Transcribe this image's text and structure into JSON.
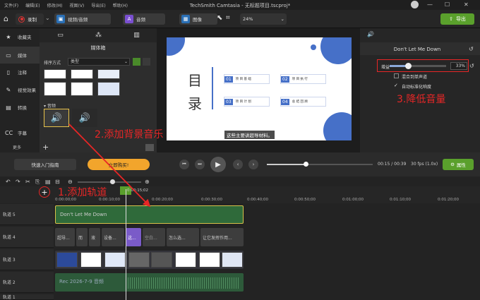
{
  "menu": {
    "items": [
      "文件(F)",
      "编辑(E)",
      "修改(M)",
      "视图(V)",
      "导出(E)",
      "帮助(H)"
    ],
    "title": "TechSmith Camtasia - 无标题项目.tscproj*"
  },
  "toolbar": {
    "record_label": "录制",
    "tabs": [
      "视频/音频",
      "音频",
      "图像"
    ],
    "zoom": "24%",
    "export_label": "导出"
  },
  "nav": {
    "items": [
      "收藏夹",
      "媒体",
      "注释",
      "视觉效果",
      "转换",
      "字幕"
    ],
    "more_label": "更多"
  },
  "media_bin": {
    "title": "媒体箱",
    "sort_label": "排序方式",
    "sort_value": "类型",
    "audio_section": "音频"
  },
  "slide": {
    "char1": "目",
    "char2": "录",
    "items": [
      {
        "num": "01",
        "text": "项 目 基 础"
      },
      {
        "num": "02",
        "text": "项 目 执 行"
      },
      {
        "num": "03",
        "text": "项 目 计 划"
      },
      {
        "num": "04",
        "text": "总 结 回 顾"
      }
    ],
    "subtitle": "这些主要讲超导材料。"
  },
  "props": {
    "title": "Don't Let Me Down",
    "gain_label": "增益",
    "gain_value": "33%",
    "gain_fraction": 0.33,
    "mix_mono_label": "混合到单声道",
    "auto_normalize_label": "自动标准化响度"
  },
  "playback": {
    "guide_label": "快速入门指南",
    "buy_label": "立即购买!",
    "time": "00:15 / 00:39",
    "fps": "30 fps (1.0x)",
    "props_label": "属性"
  },
  "timeline": {
    "ticks": [
      "0:00:00;00",
      "0:00:10;00",
      "0:00:15;02",
      "0:00:20;00",
      "0:00:30;00",
      "0:00:40;00",
      "0:00:50;00",
      "0:01:00;00",
      "0:01:10;00",
      "0:01:20;00"
    ],
    "tracks": [
      "轨道 5",
      "轨道 4",
      "轨道 3",
      "轨道 2",
      "轨道 1"
    ],
    "track5_clip": "Don't Let Me Down",
    "track4_clips": [
      "超导...",
      "而",
      "液",
      "设备...",
      "这...",
      "空白...",
      "怎么选...",
      "让它发挥作用..."
    ],
    "track2_clip": "Rec 2026-7-9 音频"
  },
  "annotations": {
    "a1": "1.添加轨道",
    "a2": "2.添加背景音乐",
    "a3": "3.降低音量"
  },
  "colors": {
    "accent_green": "#5aa02c",
    "slide_blue": "#4670c8",
    "annotation_red": "#e82626",
    "buy_orange": "#f2a52c"
  }
}
